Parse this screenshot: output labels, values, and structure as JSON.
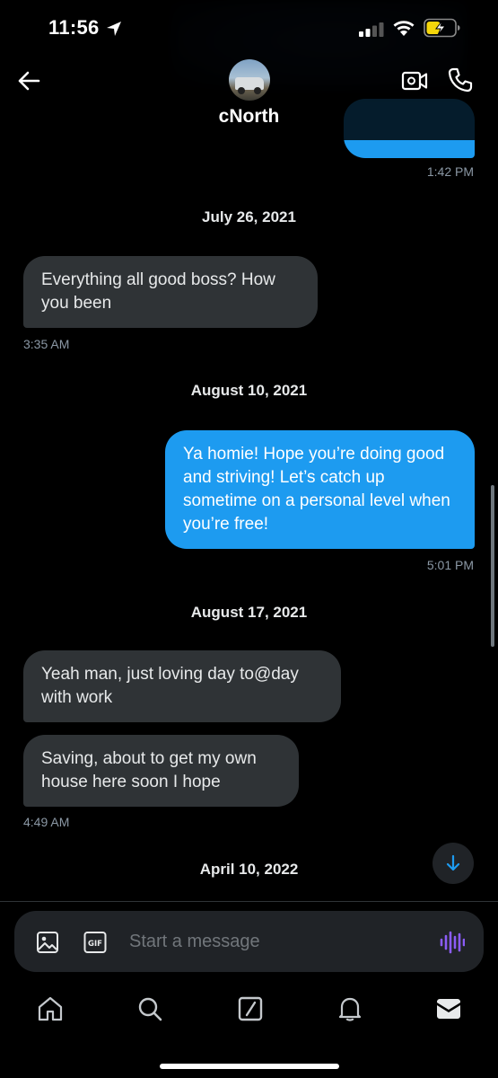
{
  "status_bar": {
    "time": "11:56"
  },
  "header": {
    "contact_name": "cNorth",
    "back_icon": "back-arrow-icon",
    "video_icon": "video-call-icon",
    "phone_icon": "phone-icon"
  },
  "messages": [
    {
      "type": "timestamp",
      "text": "1:42 PM"
    },
    {
      "type": "date",
      "text": "July 26, 2021"
    },
    {
      "type": "incoming",
      "text": "Everything all good boss? How you been"
    },
    {
      "type": "timestamp",
      "text": "3:35 AM"
    },
    {
      "type": "date",
      "text": "August 10, 2021"
    },
    {
      "type": "outgoing",
      "text": "Ya homie! Hope you’re doing good and striving! Let’s catch up sometime on a personal level when you’re free!"
    },
    {
      "type": "timestamp",
      "text": "5:01 PM"
    },
    {
      "type": "date",
      "text": "August 17, 2021"
    },
    {
      "type": "incoming",
      "text": "Yeah man, just loving day to@day with work"
    },
    {
      "type": "incoming",
      "text": "Saving, about to get my own house here soon I hope"
    },
    {
      "type": "timestamp",
      "text": "4:49 AM"
    },
    {
      "type": "date",
      "text": "April 10, 2022"
    }
  ],
  "composer": {
    "placeholder": "Start a message",
    "gif_label": "GIF"
  },
  "colors": {
    "background": "#000000",
    "incoming_bubble": "#2f3336",
    "outgoing_bubble": "#1d9bf0",
    "timestamp": "#8b98a5",
    "voice_accent": "#8b5cf6"
  },
  "nav": [
    "home-icon",
    "search-icon",
    "grok-icon",
    "notifications-icon",
    "messages-icon"
  ]
}
